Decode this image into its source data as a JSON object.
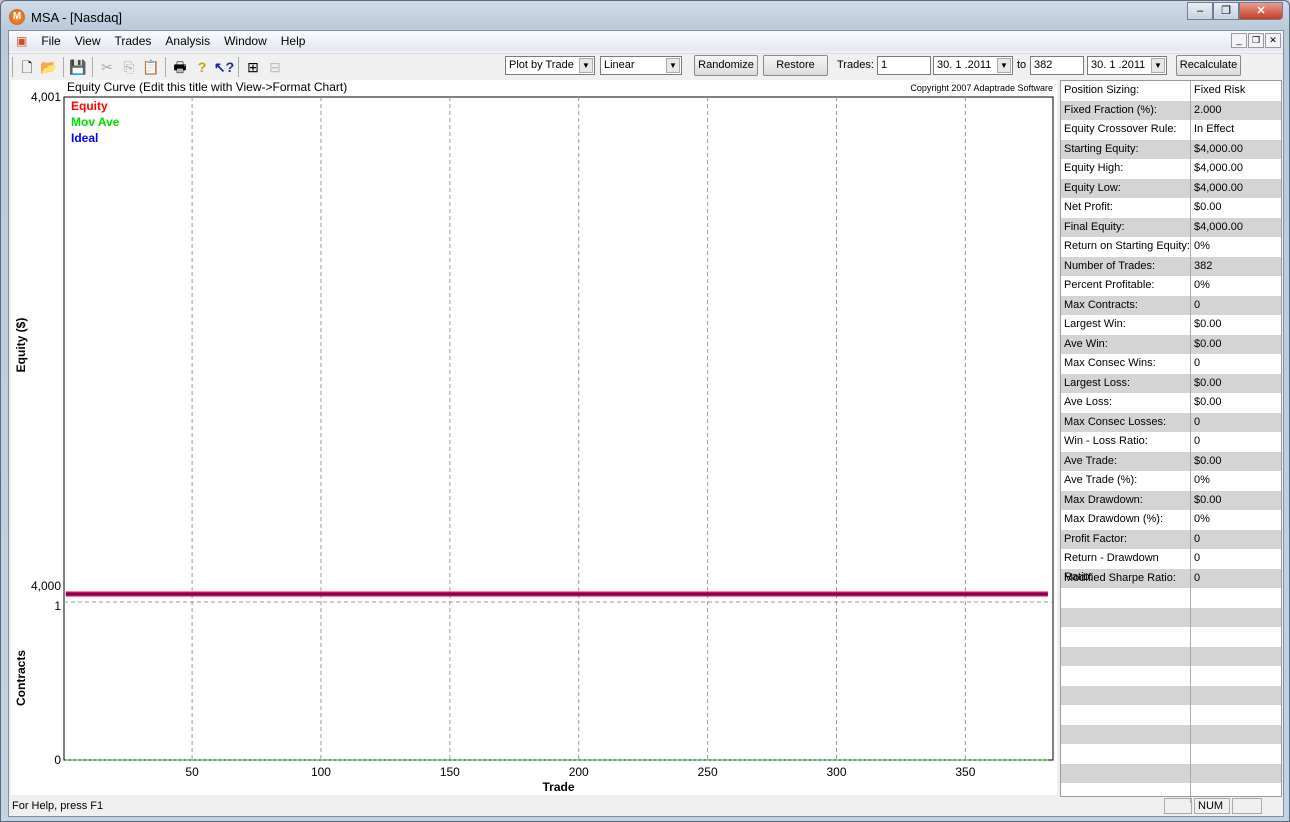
{
  "window": {
    "title": "MSA - [Nasdaq]",
    "app_icon": "M"
  },
  "menu": [
    "File",
    "View",
    "Trades",
    "Analysis",
    "Window",
    "Help"
  ],
  "toolbar": {
    "plot_mode": "Plot by Trade",
    "scale": "Linear",
    "randomize": "Randomize",
    "restore": "Restore",
    "trades_label": "Trades:",
    "trade_from": "1",
    "date_from": "30. 1 .2011",
    "to_label": "to",
    "trade_to": "382",
    "date_to": "30. 1 .2011",
    "recalculate": "Recalculate"
  },
  "chart_data": {
    "type": "line",
    "title": "Equity Curve (Edit this title with View->Format Chart)",
    "copyright": "Copyright 2007 Adaptrade Software",
    "xlabel": "Trade",
    "ylabel": "Equity ($)",
    "ylabel2": "Contracts",
    "xlim": [
      1,
      382
    ],
    "xticks": [
      "50",
      "100",
      "150",
      "200",
      "250",
      "300",
      "350"
    ],
    "xtick_values": [
      50,
      100,
      150,
      200,
      250,
      300,
      350
    ],
    "ylim": [
      4000,
      4001
    ],
    "yticks": [
      "4,001",
      "4,000"
    ],
    "ylim2": [
      0,
      1
    ],
    "yticks2": [
      "1",
      "0"
    ],
    "legend": [
      {
        "name": "Equity",
        "color": "#ff0000"
      },
      {
        "name": "Mov Ave",
        "color": "#00e000"
      },
      {
        "name": "Ideal",
        "color": "#0000ff"
      }
    ],
    "series": [
      {
        "name": "Equity",
        "x": [
          1,
          382
        ],
        "y": [
          4000,
          4000
        ]
      },
      {
        "name": "Ideal",
        "x": [
          1,
          382
        ],
        "y": [
          4000,
          4000
        ]
      },
      {
        "name": "Contracts",
        "x": [
          1,
          382
        ],
        "y": [
          0,
          0
        ]
      }
    ]
  },
  "stats": [
    [
      "Position Sizing:",
      "Fixed Risk"
    ],
    [
      "Fixed Fraction (%):",
      "2.000"
    ],
    [
      "Equity Crossover Rule:",
      "In Effect"
    ],
    [
      "Starting Equity:",
      "$4,000.00"
    ],
    [
      "Equity High:",
      "$4,000.00"
    ],
    [
      "Equity Low:",
      "$4,000.00"
    ],
    [
      "Net Profit:",
      "$0.00"
    ],
    [
      "Final Equity:",
      "$4,000.00"
    ],
    [
      "Return on Starting Equity:",
      "0%"
    ],
    [
      "Number of Trades:",
      "382"
    ],
    [
      "Percent Profitable:",
      "0%"
    ],
    [
      "Max Contracts:",
      "0"
    ],
    [
      "Largest Win:",
      "$0.00"
    ],
    [
      "Ave Win:",
      "$0.00"
    ],
    [
      "Max Consec Wins:",
      "0"
    ],
    [
      "Largest Loss:",
      "$0.00"
    ],
    [
      "Ave Loss:",
      "$0.00"
    ],
    [
      "Max Consec Losses:",
      "0"
    ],
    [
      "Win - Loss Ratio:",
      "0"
    ],
    [
      "Ave Trade:",
      "$0.00"
    ],
    [
      "Ave Trade (%):",
      "0%"
    ],
    [
      "Max Drawdown:",
      "$0.00"
    ],
    [
      "Max Drawdown (%):",
      "0%"
    ],
    [
      "Profit Factor:",
      "0"
    ],
    [
      "Return - Drawdown Ratio:",
      "0"
    ],
    [
      "Modified Sharpe Ratio:",
      "0"
    ]
  ],
  "status": {
    "help": "For Help, press F1",
    "num": "NUM"
  }
}
